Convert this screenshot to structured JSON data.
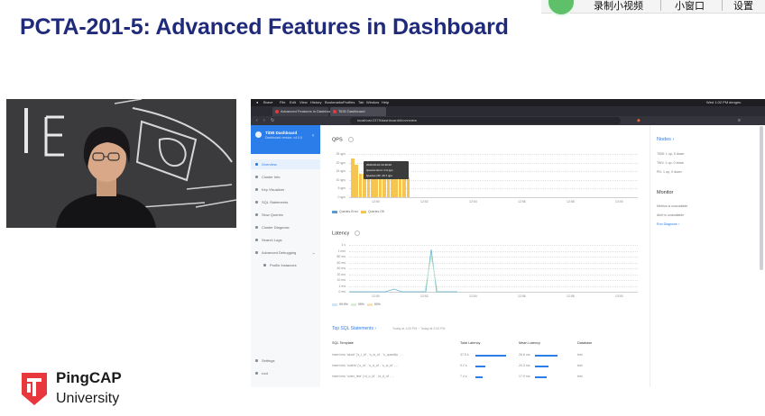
{
  "player": {
    "record_label": "录制小视频",
    "mini_window_label": "小窗口",
    "settings_label": "设置"
  },
  "slide": {
    "title": "PCTA-201-5: Advanced Features in Dashboard"
  },
  "logo": {
    "line1": "PingCAP",
    "line2": "University",
    "color": "#e8383d"
  },
  "browser": {
    "menu": [
      "Brave",
      "File",
      "Edit",
      "View",
      "History",
      "Bookmarks",
      "Profiles",
      "Tab",
      "Window",
      "Help"
    ],
    "clock": "Wed 1:02 PM",
    "user": "dengeu",
    "tabs": [
      "Advanced Features in Dashboar",
      "TiDB Dashboard"
    ],
    "url": "localhost:2379/dashboard/#/overview"
  },
  "sidebar": {
    "app_title": "TiDB Dashboard",
    "app_subtitle": "Dashboard version: v4.0.0",
    "items": [
      {
        "label": "Overview",
        "active": true
      },
      {
        "label": "Cluster Info",
        "active": false
      },
      {
        "label": "Key Visualizer",
        "active": false
      },
      {
        "label": "SQL Statements",
        "active": false
      },
      {
        "label": "Slow Queries",
        "active": false
      },
      {
        "label": "Cluster Diagnose",
        "active": false
      },
      {
        "label": "Search Logs",
        "active": false
      },
      {
        "label": "Advanced Debugging",
        "active": false
      },
      {
        "label": "Profile Instances",
        "active": false
      }
    ],
    "bottom_items": [
      "Settings",
      "root"
    ]
  },
  "qps": {
    "title": "QPS",
    "y_ticks": [
      "25 qps",
      "20 qps",
      "15 qps",
      "10 qps",
      "5 qps",
      "0 qps"
    ],
    "x_ticks": [
      "12:50",
      "12:52",
      "12:54",
      "12:56",
      "12:58",
      "13:00"
    ],
    "legend": [
      "Queries Error",
      "Queries OK"
    ],
    "tooltip": {
      "time": "2020-06-10 12:49:40",
      "error": "Queries Error: 0.0 qps",
      "ok": "Queries OK: 20.7 qps"
    }
  },
  "latency": {
    "title": "Latency",
    "y_ticks": [
      "1 s",
      "1 min",
      "80 ms",
      "60 ms",
      "40 ms",
      "20 ms",
      "10 ms",
      "1 ms",
      "0 ms"
    ],
    "x_ticks": [
      "12:50",
      "12:52",
      "12:54",
      "12:56",
      "12:58",
      "13:00"
    ],
    "legend": [
      "99.9%",
      "99%",
      "90%"
    ]
  },
  "top_sql": {
    "title": "Top SQL Statements",
    "range": "Today at 1:00 PM ~ Today at 2:00 PM",
    "headers": [
      "SQL Template",
      "Total Latency",
      "Mean Latency",
      "Database"
    ],
    "rows": [
      {
        "sql": "insert into 'stock' ('s_i_id' , 's_w_id' , 's_quantity' , ...",
        "total": "37.5 s",
        "total_frac": 0.95,
        "mean": "26.6 ms",
        "mean_frac": 0.9,
        "db": "test"
      },
      {
        "sql": "insert into 'orders' ('o_id' , 'o_d_id' , 'o_w_id' , ...",
        "total": "9.2 s",
        "total_frac": 0.3,
        "mean": "20.3 ms",
        "mean_frac": 0.55,
        "db": "test"
      },
      {
        "sql": "insert into 'order_line' ('ol_o_id' , 'ol_d_id' , ...",
        "total": "7.4 s",
        "total_frac": 0.22,
        "mean": "17.9 ms",
        "mean_frac": 0.45,
        "db": "test"
      }
    ]
  },
  "nodes": {
    "title": "Nodes",
    "rows": [
      "TiDB: 1 up, 0 down",
      "TiKV: 1 up, 0 down",
      "PD: 1 up, 0 down"
    ]
  },
  "monitor": {
    "title": "Monitor",
    "rows": [
      "Metrics is unavailable",
      "Alert is unavailable"
    ],
    "link": "Run Diagnose"
  },
  "colors": {
    "accent": "#2b7de9",
    "qps_ok": "#f5c451",
    "qps_error": "#5b9bd5",
    "latency_line": "#5fb3d9",
    "slide_title": "#1f2b7a"
  }
}
